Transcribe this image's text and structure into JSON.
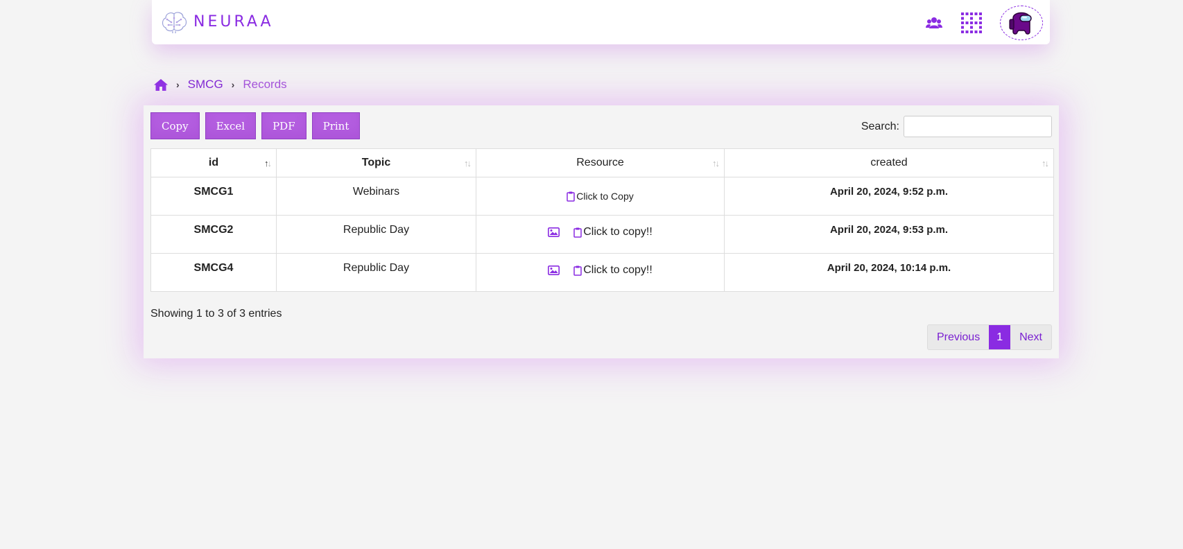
{
  "brand": {
    "name": "NEURAA"
  },
  "nav": {
    "icons": [
      "users-icon",
      "apps-grid-icon",
      "avatar"
    ]
  },
  "breadcrumb": {
    "level1": "SMCG",
    "current": "Records"
  },
  "buttons": {
    "copy": "Copy",
    "excel": "Excel",
    "pdf": "PDF",
    "print": "Print"
  },
  "search": {
    "label": "Search:",
    "placeholder": ""
  },
  "table": {
    "headers": {
      "id": "id",
      "topic": "Topic",
      "resource": "Resource",
      "created": "created"
    },
    "rows": [
      {
        "id": "SMCG1",
        "topic": "Webinars",
        "resource": "Click to Copy",
        "created": "April 20, 2024, 9:52 p.m."
      },
      {
        "id": "SMCG2",
        "topic": "Republic Day",
        "resource": "Click to copy!!",
        "created": "April 20, 2024, 9:53 p.m."
      },
      {
        "id": "SMCG4",
        "topic": "Republic Day",
        "resource": "Click to copy!!",
        "created": "April 20, 2024, 10:14 p.m."
      }
    ]
  },
  "footer": {
    "info": "Showing 1 to 3 of 3 entries"
  },
  "pagination": {
    "previous": "Previous",
    "current": "1",
    "next": "Next"
  },
  "colors": {
    "accent": "#8a2be2",
    "button": "#b45ee0"
  }
}
